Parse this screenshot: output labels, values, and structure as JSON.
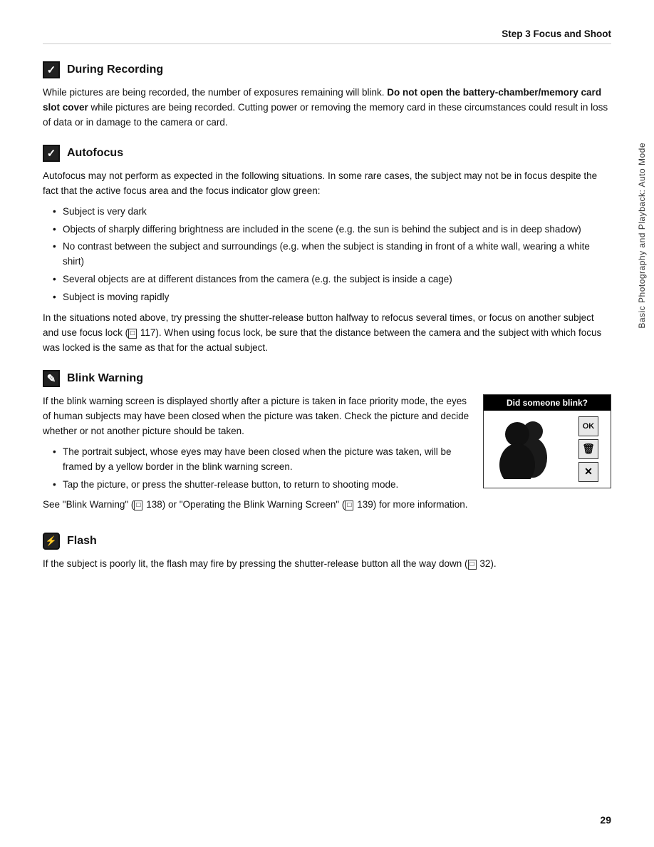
{
  "header": {
    "title": "Step 3 Focus and Shoot"
  },
  "page_number": "29",
  "sidebar_text": "Basic Photography and Playback: Auto Mode",
  "sections": [
    {
      "id": "during-recording",
      "icon_type": "checked",
      "icon_symbol": "✓",
      "title": "During Recording",
      "paragraphs": [
        "While pictures are being recorded, the number of exposures remaining will blink. <b>Do not open the battery-chamber/memory card slot cover</b> while pictures are being recorded. Cutting power or removing the memory card in these circumstances could result in loss of data or in damage to the camera or card."
      ],
      "bullets": []
    },
    {
      "id": "autofocus",
      "icon_type": "checked",
      "icon_symbol": "✓",
      "title": "Autofocus",
      "paragraphs": [
        "Autofocus may not perform as expected in the following situations. In some rare cases, the subject may not be in focus despite the fact that the active focus area and the focus indicator glow green:"
      ],
      "bullets": [
        "Subject is very dark",
        "Objects of sharply differing brightness are included in the scene (e.g. the sun is behind the subject and is in deep shadow)",
        "No contrast between the subject and surroundings (e.g. when the subject is standing in front of a white wall, wearing a white shirt)",
        "Several objects are at different distances from the camera (e.g. the subject is inside a cage)",
        "Subject is moving rapidly"
      ],
      "after_bullets": "In the situations noted above, try pressing the shutter-release button halfway to refocus several times, or focus on another subject and use focus lock (<span class=\"book-icon\">□</span> 117). When using focus lock, be sure that the distance between the camera and the subject with which focus was locked is the same as that for the actual subject."
    },
    {
      "id": "blink-warning",
      "icon_type": "pencil",
      "icon_symbol": "✎",
      "title": "Blink Warning",
      "paragraphs": [
        "If the blink warning screen is displayed shortly after a picture is taken in face priority mode, the eyes of human subjects may have been closed when the picture was taken. Check the picture and decide whether or not another picture should be taken."
      ],
      "bullets": [
        "The portrait subject, whose eyes may have been closed when the picture was taken, will be framed by a yellow border in the blink warning screen.",
        "Tap the picture, or press the shutter-release button, to return to shooting mode."
      ],
      "after_bullets": "See \"Blink Warning\" (<span class=\"book-icon\">□</span> 138) or \"Operating the Blink Warning Screen\" (<span class=\"book-icon\">□</span> 139) for more information.",
      "image": {
        "title": "Did someone blink?",
        "buttons": [
          "OK",
          "🗑",
          "✕"
        ]
      }
    },
    {
      "id": "flash",
      "icon_type": "camera",
      "icon_symbol": "⚡",
      "title": "Flash",
      "paragraphs": [
        "If the subject is poorly lit, the flash may fire by pressing the shutter-release button all the way down (<span class=\"book-icon\">□</span> 32)."
      ],
      "bullets": []
    }
  ]
}
